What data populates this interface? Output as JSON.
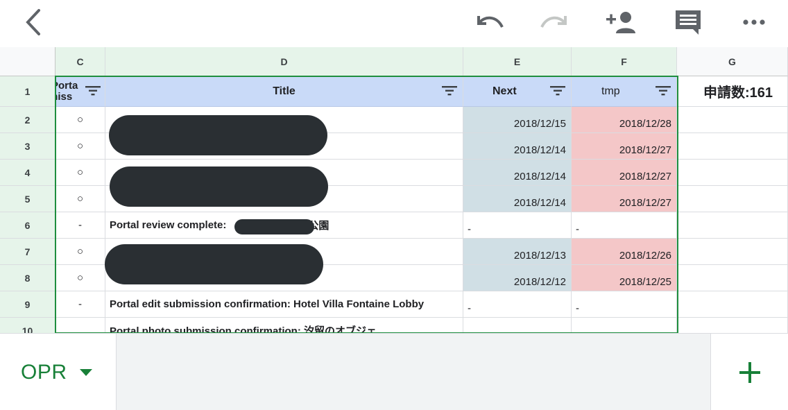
{
  "toolbar": {
    "icons": [
      "back-icon",
      "undo-icon",
      "redo-icon",
      "add-person-icon",
      "comment-icon",
      "more-icon"
    ]
  },
  "columns": [
    "C",
    "D",
    "E",
    "F",
    "G"
  ],
  "rows": [
    "1",
    "2",
    "3",
    "4",
    "5",
    "6",
    "7",
    "8",
    "9",
    "10"
  ],
  "header": {
    "c_line1": "Porta",
    "c_line2": "miss",
    "title": "Title",
    "next": "Next",
    "tmp": "tmp",
    "count": "申請数:161"
  },
  "data": [
    {
      "c": "○",
      "d": "",
      "e": "2018/12/15",
      "f": "2018/12/28"
    },
    {
      "c": "○",
      "d": "",
      "e": "2018/12/14",
      "f": "2018/12/27"
    },
    {
      "c": "○",
      "d": "",
      "e": "2018/12/14",
      "f": "2018/12/27"
    },
    {
      "c": "○",
      "d": "",
      "e": "2018/12/14",
      "f": "2018/12/27"
    },
    {
      "c": "-",
      "d": "Portal review complete:",
      "d_suffix": "公園",
      "e": "-",
      "f": "-"
    },
    {
      "c": "○",
      "d": "",
      "e": "2018/12/13",
      "f": "2018/12/26"
    },
    {
      "c": "○",
      "d": "",
      "e": "2018/12/12",
      "f": "2018/12/25"
    },
    {
      "c": "-",
      "d": "Portal edit submission confirmation: Hotel Villa Fontaine Lobby",
      "e": "-",
      "f": "-"
    },
    {
      "c": "",
      "d": "Portal photo submission confirmation: 汐留のオブジェ",
      "e": "",
      "f": ""
    }
  ],
  "sheet": {
    "name": "OPR"
  },
  "colors": {
    "accent": "#188038",
    "selection": "#1e8e3e",
    "header_fill": "#c9daf8",
    "next_fill": "#d0dfe5",
    "tmp_fill": "#f4c7c8"
  }
}
